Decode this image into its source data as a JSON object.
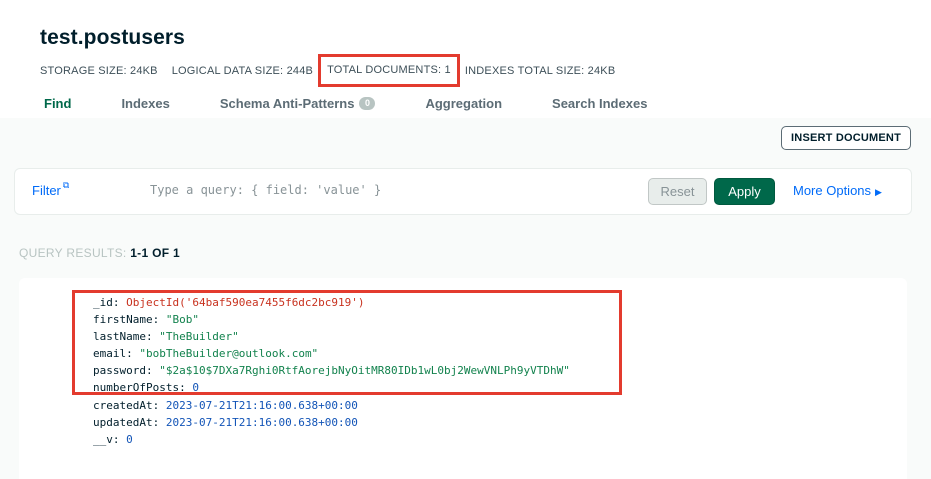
{
  "header": {
    "title": "test.postusers",
    "stats": [
      "STORAGE SIZE: 24KB",
      "LOGICAL DATA SIZE: 244B",
      "TOTAL DOCUMENTS: 1",
      "INDEXES TOTAL SIZE: 24KB"
    ],
    "tabs": [
      {
        "label": "Find"
      },
      {
        "label": "Indexes"
      },
      {
        "label": "Schema Anti-Patterns",
        "badge": "0"
      },
      {
        "label": "Aggregation"
      },
      {
        "label": "Search Indexes"
      }
    ]
  },
  "toolbar": {
    "insert_label": "INSERT DOCUMENT"
  },
  "filter": {
    "label": "Filter",
    "placeholder": "Type a query: { field: 'value' }",
    "reset_label": "Reset",
    "apply_label": "Apply",
    "more_options_label": "More Options"
  },
  "results": {
    "prefix": "QUERY RESULTS: ",
    "count": "1-1 OF 1"
  },
  "document": {
    "fields": [
      {
        "key": "_id",
        "value": "ObjectId('64baf590ea7455f6dc2bc919')",
        "type": "oid"
      },
      {
        "key": "firstName",
        "value": "\"Bob\"",
        "type": "str"
      },
      {
        "key": "lastName",
        "value": "\"TheBuilder\"",
        "type": "str"
      },
      {
        "key": "email",
        "value": "\"bobTheBuilder@outlook.com\"",
        "type": "str"
      },
      {
        "key": "password",
        "value": "\"$2a$10$7DXa7Rghi0RtfAorejbNyOitMR80IDb1wL0bj2WewVNLPh9yVTDhW\"",
        "type": "str"
      },
      {
        "key": "numberOfPosts",
        "value": "0",
        "type": "num"
      },
      {
        "key": "createdAt",
        "value": "2023-07-21T21:16:00.638+00:00",
        "type": "num"
      },
      {
        "key": "updatedAt",
        "value": "2023-07-21T21:16:00.638+00:00",
        "type": "num"
      },
      {
        "key": "__v",
        "value": "0",
        "type": "num"
      }
    ]
  },
  "colors": {
    "accent_green": "#00684a",
    "link_blue": "#016bf8",
    "highlight_red": "#e33b2e"
  }
}
